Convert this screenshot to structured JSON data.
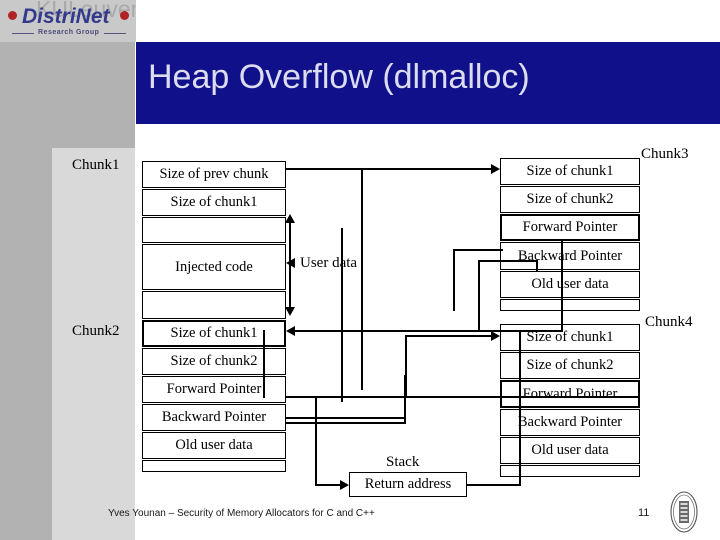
{
  "slide": {
    "title": "Heap Overflow (dlmalloc)",
    "page_number": "11",
    "footer": "Yves Younan – Security of Memory Allocators for C and C++",
    "colors": {
      "banner": "#10108a",
      "title_text": "#dcdcf0",
      "sidebar_dark": "#b2b2b2",
      "sidebar_light": "#d9d9d9",
      "logo_blue": "#333a8c",
      "logo_dot": "#b22222"
    }
  },
  "logo": {
    "university": "KULeuven",
    "group": "DistriNet",
    "tagline": "Research Group"
  },
  "diagram": {
    "chunk_labels": {
      "chunk1": "Chunk1",
      "chunk2": "Chunk2",
      "chunk3": "Chunk3",
      "chunk4": "Chunk4"
    },
    "annotations": {
      "user_data": "User data",
      "stack": "Stack"
    },
    "left_column": [
      {
        "text": "Size of prev chunk",
        "empty": false
      },
      {
        "text": "Size of chunk1",
        "empty": false
      },
      {
        "text": "",
        "empty": true
      },
      {
        "text": "Injected code",
        "empty": false
      },
      {
        "text": "",
        "empty": true
      },
      {
        "text": "Size of chunk1",
        "empty": false
      },
      {
        "text": "Size of chunk2",
        "empty": false
      },
      {
        "text": "Forward Pointer",
        "empty": false
      },
      {
        "text": "Backward Pointer",
        "empty": false
      },
      {
        "text": "Old user data",
        "empty": false
      },
      {
        "text": "",
        "empty": true
      }
    ],
    "chunk3_rows": [
      "Size of chunk1",
      "Size of chunk2",
      "Forward Pointer",
      "Backward Pointer",
      "Old user data"
    ],
    "chunk4_rows": [
      "Size of chunk1",
      "Size of chunk2",
      "Forward Pointer",
      "Backward Pointer",
      "Old user data"
    ],
    "stack_box": "Return address"
  }
}
